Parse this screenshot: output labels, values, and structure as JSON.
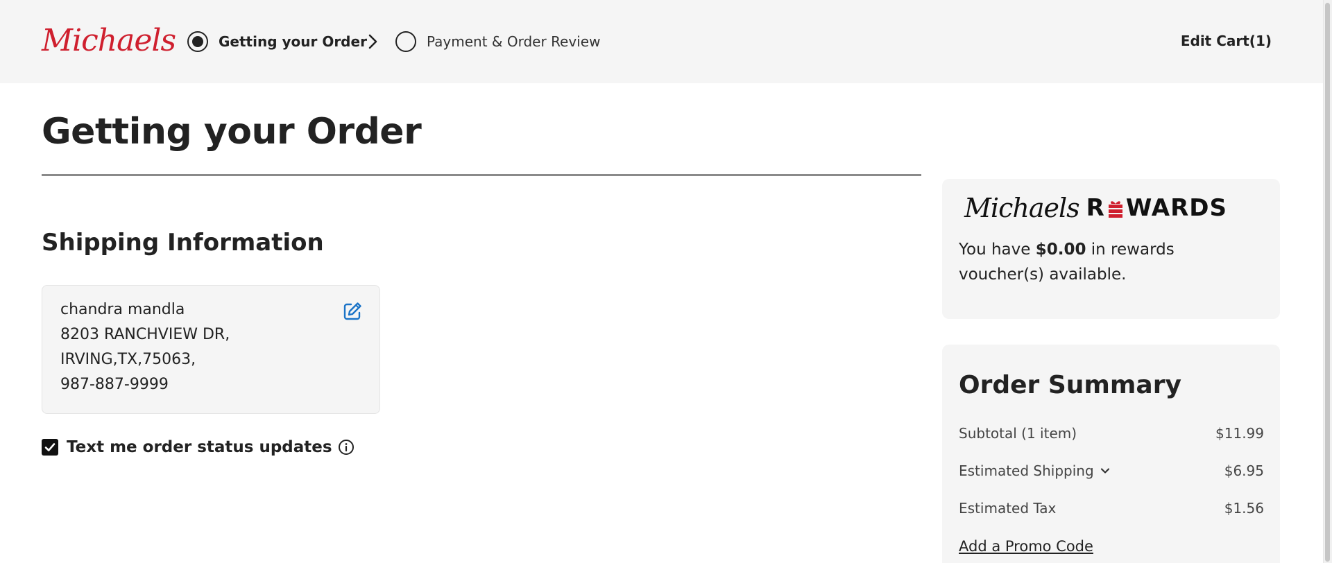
{
  "header": {
    "logo_text": "Michaels",
    "steps": [
      {
        "label": "Getting your Order",
        "state": "active"
      },
      {
        "label": "Payment & Order Review",
        "state": "inactive"
      }
    ],
    "edit_cart_label": "Edit Cart(1)"
  },
  "main": {
    "page_title": "Getting your Order",
    "shipping": {
      "section_title": "Shipping Information",
      "address": {
        "name": "chandra mandla",
        "street": "8203 RANCHVIEW DR,",
        "city_state_zip": "IRVING,TX,75063,",
        "phone": "987-887-9999"
      },
      "sms_checkbox": {
        "label": "Text me order status updates",
        "checked": true
      }
    }
  },
  "rewards": {
    "logo_script": "Michaels",
    "logo_word_start": "R",
    "logo_word_end": "WARDS",
    "text_prefix": "You have ",
    "amount": "$0.00",
    "text_suffix": " in rewards voucher(s) available."
  },
  "order_summary": {
    "title": "Order Summary",
    "rows": [
      {
        "label": "Subtotal (1 item)",
        "value": "$11.99"
      },
      {
        "label": "Estimated Shipping",
        "value": "$6.95"
      },
      {
        "label": "Estimated Tax",
        "value": "$1.56"
      }
    ],
    "promo_link": "Add a Promo Code"
  },
  "colors": {
    "brand_red": "#cf1f2e",
    "link_blue": "#1a73c7",
    "header_bg": "#f5f5f5"
  },
  "icons": [
    "radio-selected-icon",
    "radio-empty-icon",
    "chevron-right-icon",
    "edit-icon",
    "checkbox-checked-icon",
    "info-icon",
    "gift-icon",
    "chevron-down-icon"
  ]
}
